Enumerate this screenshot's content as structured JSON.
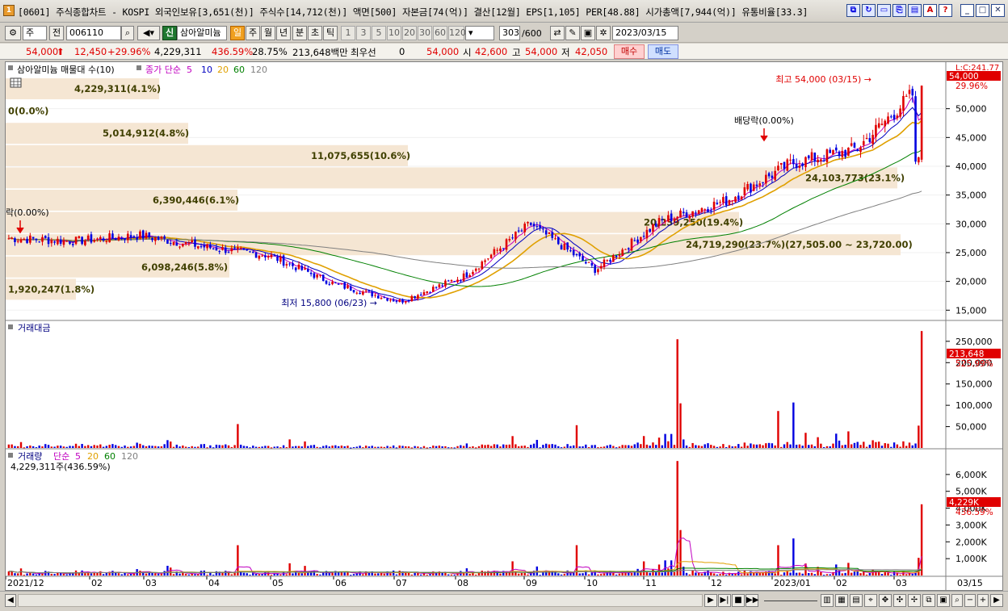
{
  "window": {
    "title": "[0601] 주식종합차트 - KOSPI 외국인보유[3,651(천)] 주식수[14,712(천)] 액면[500] 자본금[74(억)] 결산[12월] EPS[1,105] PER[48.88] 시가총액[7,944(억)] 유통비율[33.3]",
    "app_icon": "1"
  },
  "toolbar": {
    "market": "주",
    "prev_label": "전",
    "code": "006110",
    "credit_label": "신",
    "stock_name": "삼아알미늄",
    "period_tabs": [
      "일",
      "주",
      "월",
      "년",
      "분",
      "초",
      "틱"
    ],
    "active_period": "일",
    "interval_buttons": [
      "1",
      "3",
      "5",
      "10",
      "20",
      "30",
      "60",
      "120"
    ],
    "count": "303",
    "count_max": "/600",
    "date": "2023/03/15"
  },
  "infobar": {
    "price": "54,000",
    "arrow": "⬆",
    "change": "12,450",
    "change_pct": "+29.96%",
    "volume": "4,229,311",
    "volume_pct": "436.59%",
    "turnover": "28.75%",
    "amount": "213,648백만",
    "priority_label": "최우선",
    "priority_value": "0",
    "quote_price": "54,000",
    "open_label": "시",
    "open": "42,600",
    "high_label": "고",
    "high": "54,000",
    "low_label": "저",
    "low": "42,050",
    "buy_label": "매수",
    "sell_label": "매도"
  },
  "price_panel": {
    "legend_name": "삼아알미늄 매물대 수(10)",
    "legend_ma": "종가 단순",
    "ma_periods": [
      "5",
      "10",
      "20",
      "60",
      "120"
    ],
    "ma_colors": [
      "#c000c0",
      "#0000c0",
      "#e0a000",
      "#008000",
      "#808080"
    ],
    "high_annotation": "최고 54,000 (03/15) →",
    "low_annotation": "최저 15,800 (06/23) →",
    "dividend_label_1": "배당락(0.00%)",
    "dividend_label_2": "락(0.00%)",
    "axis_top_label": "L:C:241.77",
    "current_price_tag": "54,000",
    "current_pct_tag": "29.96%",
    "y_ticks": [
      "50,000",
      "45,000",
      "40,000",
      "35,000",
      "30,000",
      "25,000",
      "20,000",
      "15,000"
    ],
    "volume_profile": [
      {
        "label": "4,229,311(4.1%)"
      },
      {
        "label": "0(0.0%)"
      },
      {
        "label": "5,014,912(4.8%)"
      },
      {
        "label": "11,075,655(10.6%)"
      },
      {
        "label": "24,103,773(23.1%)"
      },
      {
        "label": "6,390,446(6.1%)"
      },
      {
        "label": "20,239,250(19.4%)"
      },
      {
        "label": "24,719,290(23.7%)(27,505.00 ~ 23,720.00)"
      },
      {
        "label": "6,098,246(5.8%)"
      },
      {
        "label": "1,920,247(1.8%)"
      }
    ]
  },
  "amount_panel": {
    "legend_name": "거래대금",
    "y_ticks": [
      "250,000",
      "200,000",
      "150,000",
      "100,000",
      "50,000"
    ],
    "value_tag": "213,648",
    "pct_tag": "525.99%"
  },
  "volume_panel": {
    "legend_name": "거래량",
    "legend_ma": "단순",
    "ma_periods": [
      "5",
      "20",
      "60",
      "120"
    ],
    "ma_colors": [
      "#c000c0",
      "#e0a000",
      "#008000",
      "#808080"
    ],
    "sub_label": "4,229,311주(436.59%)",
    "y_ticks": [
      "6,000K",
      "5,000K",
      "4,000K",
      "3,000K",
      "2,000K",
      "1,000K"
    ],
    "value_tag": "4,229K",
    "pct_tag": "436.59%"
  },
  "x_axis": {
    "labels": [
      "2021/12",
      "02",
      "03",
      "04",
      "05",
      "06",
      "07",
      "08",
      "09",
      "10",
      "11",
      "12",
      "2023/01",
      "02",
      "03"
    ],
    "right_label": "03/15"
  },
  "colors": {
    "up": "#e00000",
    "down": "#0000e0",
    "profile_band": "#f5e6d3",
    "tag_bg": "#e00000"
  },
  "chart_data": {
    "type": "candlestick",
    "price_range": [
      13500,
      55000
    ],
    "close_keypoints": [
      {
        "month": "2021/12",
        "close": 27500
      },
      {
        "month": "02",
        "close": 27000
      },
      {
        "month": "03",
        "close": 28000
      },
      {
        "month": "04",
        "close": 26000
      },
      {
        "month": "05",
        "close": 24500
      },
      {
        "month": "06",
        "close": 19500
      },
      {
        "month": "07",
        "close": 16500
      },
      {
        "month": "08",
        "close": 21000
      },
      {
        "month": "09",
        "close": 30000
      },
      {
        "month": "10",
        "close": 22000
      },
      {
        "month": "11",
        "close": 30500
      },
      {
        "month": "12",
        "close": 34000
      },
      {
        "month": "2023/01",
        "close": 40500
      },
      {
        "month": "02",
        "close": 43000
      },
      {
        "month": "03",
        "close": 54000
      }
    ],
    "highest": {
      "value": 54000,
      "date": "03/15"
    },
    "lowest": {
      "value": 15800,
      "date": "06/23"
    }
  }
}
